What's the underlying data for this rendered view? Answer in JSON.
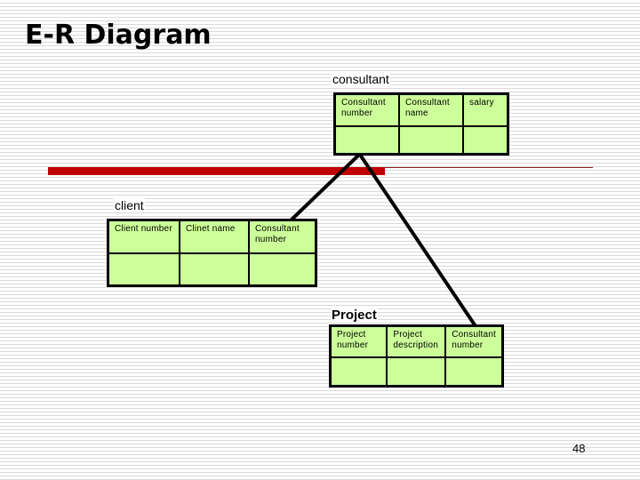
{
  "slide": {
    "title": "E-R Diagram",
    "page_number": "48"
  },
  "colors": {
    "entity_fill": "#ccff99",
    "accent_red": "#c00000",
    "stripe": "#d9d9d9"
  },
  "entities": {
    "consultant": {
      "name": "consultant",
      "attributes": [
        "Consultant number",
        "Consultant name",
        "salary"
      ]
    },
    "client": {
      "name": "client",
      "attributes": [
        "Client number",
        "Clinet name",
        "Consultant number"
      ]
    },
    "project": {
      "name": "Project",
      "attributes": [
        "Project number",
        "Project description",
        "Consultant number"
      ]
    }
  },
  "relationships": [
    {
      "from": "consultant",
      "to": "client"
    },
    {
      "from": "consultant",
      "to": "project"
    }
  ]
}
